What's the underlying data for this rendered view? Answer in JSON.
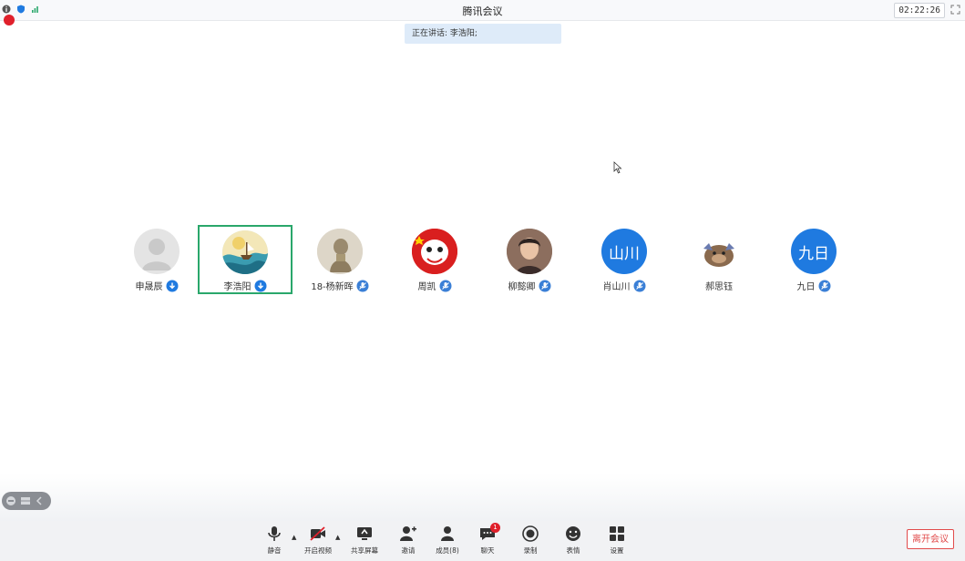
{
  "window": {
    "title": "腾讯会议",
    "timer": "02:22:26"
  },
  "speaking": {
    "text": "正在讲话: 李浩阳;"
  },
  "participants": [
    {
      "name": "申晟辰",
      "avatar": "grey-person",
      "mic": "download-icon",
      "active": false
    },
    {
      "name": "李浩阳",
      "avatar": "painting",
      "mic": "download-icon",
      "active": true
    },
    {
      "name": "18-杨新晖",
      "avatar": "statue",
      "mic": "mic-muted-icon",
      "active": false
    },
    {
      "name": "周凯",
      "avatar": "cartoon",
      "mic": "mic-muted-icon",
      "active": false
    },
    {
      "name": "柳懿卿",
      "avatar": "photo",
      "mic": "mic-muted-icon",
      "active": false
    },
    {
      "name": "肖山川",
      "avatar_text": "山川",
      "mic": "mic-muted-icon",
      "active": false
    },
    {
      "name": "郝思钰",
      "avatar": "animal",
      "mic": "none",
      "active": false
    },
    {
      "name": "九日",
      "avatar_text": "九日",
      "mic": "mic-muted-icon",
      "active": false
    }
  ],
  "toolbar": {
    "mute": "静音",
    "video": "开启视频",
    "share": "共享屏幕",
    "invite": "邀请",
    "members": "成员(8)",
    "chat": "聊天",
    "chat_badge": "1",
    "record": "录制",
    "reactions": "表情",
    "settings": "设置",
    "leave": "离开会议"
  },
  "colors": {
    "accent": "#1f7ae0",
    "active_border": "#2aa76b",
    "leave": "#e14b4b",
    "record": "#e0202b"
  }
}
